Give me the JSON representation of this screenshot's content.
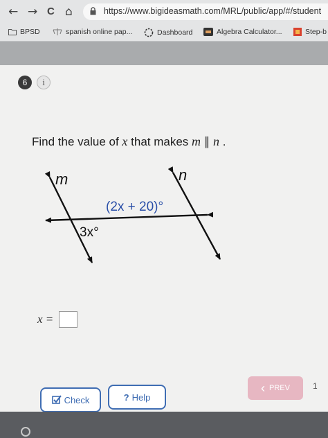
{
  "browser": {
    "nav": {
      "back": "←",
      "forward": "→",
      "reload": "C",
      "home": "⌂"
    },
    "url": "https://www.bigideasmath.com/MRL/public/app/#/student"
  },
  "bookmarks": [
    {
      "label": "BPSD",
      "icon": "folder-icon"
    },
    {
      "label": "spanish online pap...",
      "icon": "scale-icon"
    },
    {
      "label": "Dashboard",
      "icon": "canvas-icon"
    },
    {
      "label": "Algebra Calculator...",
      "icon": "mathpapa-icon"
    },
    {
      "label": "Step-b",
      "icon": "orange-square-icon"
    }
  ],
  "question": {
    "number": "6",
    "info": "i",
    "prompt": {
      "text_before": "Find the value of ",
      "var": "x",
      "text_middle": " that makes ",
      "line1": "m",
      "parallel": " ∥ ",
      "line2": "n",
      "end": " ."
    },
    "diagram": {
      "label_m": "m",
      "label_n": "n",
      "angle_top": "(2x + 20)°",
      "angle_bottom": "3x°"
    },
    "answer": {
      "label": "x =",
      "value": ""
    }
  },
  "buttons": {
    "check": "Check",
    "help": "Help",
    "help_icon": "?",
    "prev": "PREV",
    "page": "1"
  },
  "colors": {
    "accent": "#3f6db3",
    "prev_bg": "#e7b7c2"
  }
}
